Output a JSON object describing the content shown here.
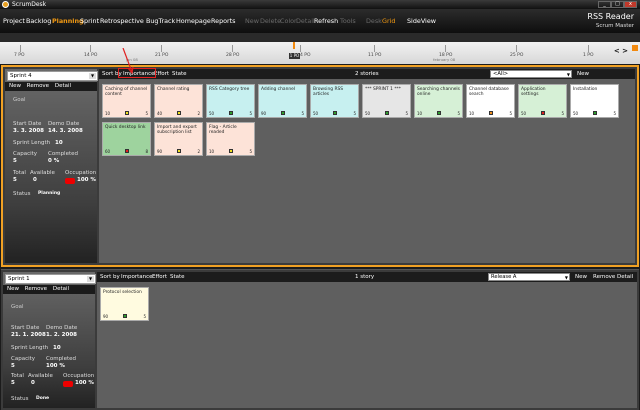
{
  "window": {
    "title": "ScrumDesk",
    "min": "_",
    "max": "□",
    "close": "x"
  },
  "menu": {
    "items": [
      "Project",
      "Backlog",
      "Planning",
      "Sprint",
      "Retrospective",
      "BugTrack",
      "Homepage",
      "Reports",
      "New",
      "Delete",
      "Color",
      "Detail",
      "Refresh",
      "Tools",
      "Desk",
      "Grid",
      "SideView"
    ],
    "active": "Planning",
    "product": "RSS Reader",
    "role": "Scrum Master"
  },
  "timeline": {
    "ticks": [
      "7 PO",
      "14 PO",
      "21 PO",
      "28 PO",
      "4 PO",
      "11 PO",
      "18 PO",
      "25 PO",
      "1 PO"
    ],
    "subs": [
      "jan 08",
      "february 08"
    ],
    "today": "1 PO",
    "nav": "< >"
  },
  "sprints": [
    {
      "name": "Sprint 4",
      "btn_new": "New",
      "btn_remove": "Remove",
      "btn_detail": "Detail",
      "goal_label": "Goal",
      "start_label": "Start Date",
      "demo_label": "Demo Date",
      "start": "3. 3. 2008",
      "demo": "14. 3. 2008",
      "length_label": "Sprint Length",
      "length": "10",
      "capacity_label": "Capacity",
      "completed_label": "Completed",
      "capacity": "5",
      "completed": "0 %",
      "total_label": "Total",
      "available_label": "Available",
      "occupation_label": "Occupation",
      "total": "5",
      "available": "0",
      "occupation": "100 %",
      "status_label": "Status",
      "status": "Planning",
      "sort": [
        "Sort by",
        "Importance",
        "Effort",
        "State"
      ],
      "count": "2 stories",
      "filter": "<All>",
      "board_new": "New",
      "cards": [
        {
          "title": "Caching of channel content",
          "n": "10",
          "e": "5",
          "bg": "#fde3d8",
          "sq": "#f0e020"
        },
        {
          "title": "Channel rating",
          "n": "40",
          "e": "2",
          "bg": "#fde3d8",
          "sq": "#f0e020"
        },
        {
          "title": "RSS Category tree",
          "n": "50",
          "e": "5",
          "bg": "#c7f0f0",
          "sq": "#2ca02c"
        },
        {
          "title": "Adding channel",
          "n": "90",
          "e": "5",
          "bg": "#c7f0f0",
          "sq": "#2ca02c"
        },
        {
          "title": "Browsing RSS articles",
          "n": "50",
          "e": "5",
          "bg": "#c7f0f0",
          "sq": "#2ca02c"
        },
        {
          "title": "*** SPRINT 1 ***",
          "n": "50",
          "e": "5",
          "bg": "#e6e6e6",
          "sq": "#2ca02c"
        },
        {
          "title": "Searching channels online",
          "n": "10",
          "e": "5",
          "bg": "#d6f0d6",
          "sq": "#2ca02c"
        },
        {
          "title": "Channel database search",
          "n": "10",
          "e": "5",
          "bg": "#ffffff",
          "sq": "#f09020"
        },
        {
          "title": "Application settings",
          "n": "50",
          "e": "5",
          "bg": "#d6f0d6",
          "sq": "#e02020"
        },
        {
          "title": "Installation",
          "n": "50",
          "e": "5",
          "bg": "#ffffff",
          "sq": "#2ca02c"
        },
        {
          "title": "Quick desktop link",
          "n": "60",
          "e": "8",
          "bg": "#9ed39e",
          "sq": "#e02020"
        },
        {
          "title": "Import and export subscription list",
          "n": "90",
          "e": "2",
          "bg": "#fde3d8",
          "sq": "#f0e020"
        },
        {
          "title": "Flag - Article readed",
          "n": "10",
          "e": "5",
          "bg": "#fde3d8",
          "sq": "#f0e020"
        }
      ]
    },
    {
      "name": "Sprint 1",
      "btn_new": "New",
      "btn_remove": "Remove",
      "btn_detail": "Detail",
      "goal_label": "Goal",
      "start_label": "Start Date",
      "demo_label": "Demo Date",
      "start": "21. 1. 2008",
      "demo": "1. 2. 2008",
      "length_label": "Sprint Length",
      "length": "10",
      "capacity_label": "Capacity",
      "completed_label": "Completed",
      "capacity": "5",
      "completed": "100 %",
      "total_label": "Total",
      "available_label": "Available",
      "occupation_label": "Occupation",
      "total": "5",
      "available": "0",
      "occupation": "100 %",
      "status_label": "Status",
      "status": "Done",
      "sort": [
        "Sort by",
        "Importance",
        "Effort",
        "State"
      ],
      "count": "1 story",
      "filter": "Release A",
      "board_new": "New",
      "board_remove": "Remove",
      "board_detail": "Detail",
      "cards": [
        {
          "title": "Protocol selection",
          "n": "90",
          "e": "5",
          "bg": "#fffbe0",
          "sq": "#2ca02c"
        }
      ]
    }
  ]
}
